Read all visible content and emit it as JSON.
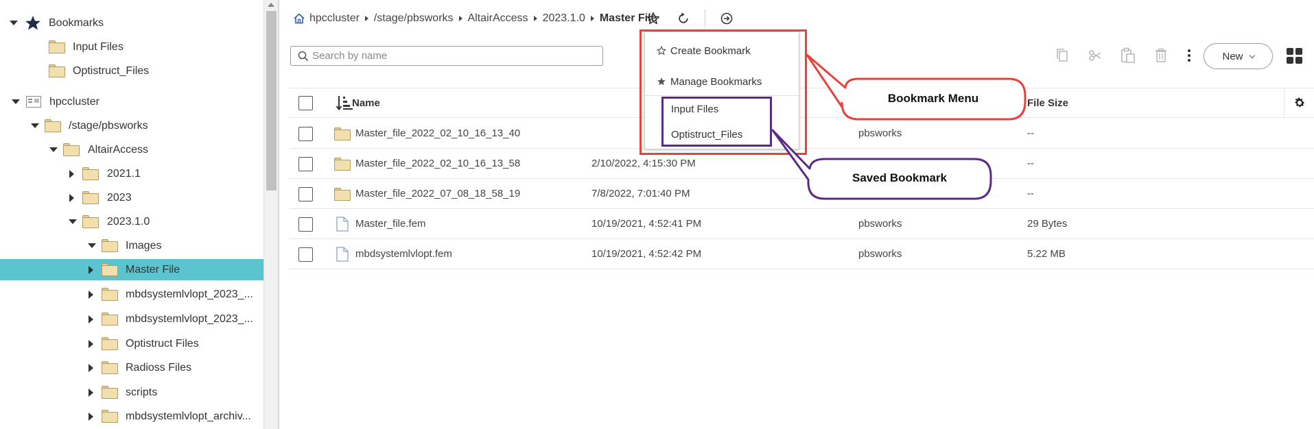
{
  "sidebar": {
    "bookmarks_label": "Bookmarks",
    "bookmarks": [
      "Input Files",
      "Optistruct_Files"
    ],
    "tree": {
      "root": "hpccluster",
      "stage": "/stage/pbsworks",
      "altair": "AltairAccess",
      "children_altair": [
        "2021.1",
        "2023"
      ],
      "version": "2023.1.0",
      "children_version": [
        "Images",
        "Master File",
        "mbdsystemlvlopt_2023_...",
        "mbdsystemlvlopt_2023_...",
        "Optistruct Files",
        "Radioss Files",
        "scripts",
        "mbdsystemlvlopt_archiv..."
      ],
      "selected": "Master File"
    }
  },
  "breadcrumb": {
    "items": [
      "hpccluster",
      "/stage/pbsworks",
      "AltairAccess",
      "2023.1.0"
    ],
    "current": "Master File"
  },
  "toolbar": {
    "search_placeholder": "Search by name",
    "new_label": "New"
  },
  "table": {
    "columns": [
      "Name",
      "File Size"
    ],
    "rows": [
      {
        "name": "Master_file_2022_02_10_16_13_40",
        "modified": "",
        "owner": "pbsworks",
        "size": "--",
        "type": "folder"
      },
      {
        "name": "Master_file_2022_02_10_16_13_58",
        "modified": "2/10/2022, 4:15:30 PM",
        "owner": "",
        "size": "--",
        "type": "folder"
      },
      {
        "name": "Master_file_2022_07_08_18_58_19",
        "modified": "7/8/2022, 7:01:40 PM",
        "owner": "",
        "size": "--",
        "type": "folder"
      },
      {
        "name": "Master_file.fem",
        "modified": "10/19/2021, 4:52:41 PM",
        "owner": "pbsworks",
        "size": "29 Bytes",
        "type": "file"
      },
      {
        "name": "mbdsystemlvlopt.fem",
        "modified": "10/19/2021, 4:52:42 PM",
        "owner": "pbsworks",
        "size": "5.22 MB",
        "type": "file"
      }
    ]
  },
  "bookmark_menu": {
    "create": "Create Bookmark",
    "manage": "Manage Bookmarks",
    "saved": [
      "Input Files",
      "Optistruct_Files"
    ]
  },
  "annotations": {
    "bookmark_menu": "Bookmark Menu",
    "saved_bookmark": "Saved Bookmark"
  },
  "colors": {
    "selected_row": "#5bc4cf",
    "annotation_red": "#e8413b",
    "annotation_purple": "#5b2a86",
    "folder_fill": "#f2dfae"
  },
  "icons": {
    "bookmark": "star-icon",
    "refresh": "refresh-icon",
    "navigate": "arrow-circle-icon",
    "copy": "copy-icon",
    "cut": "scissors-icon",
    "paste": "paste-icon",
    "delete": "trash-icon",
    "more": "kebab-icon",
    "view": "grid-view-icon",
    "settings": "gear-icon"
  }
}
